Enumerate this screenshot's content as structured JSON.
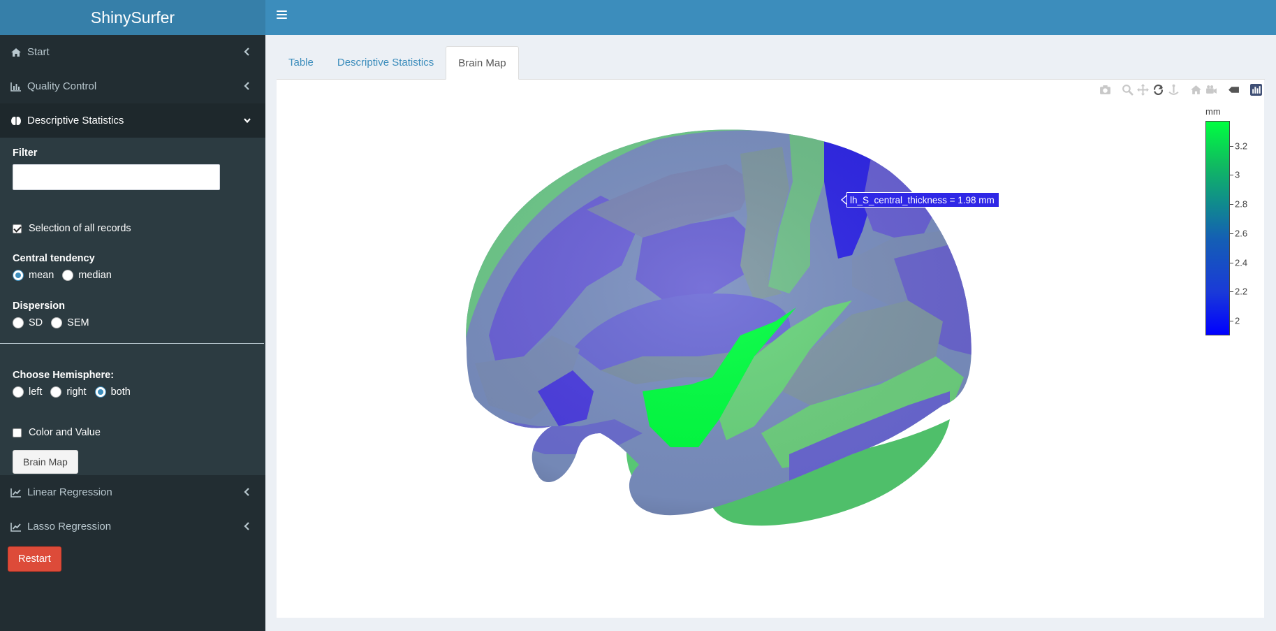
{
  "app": {
    "title": "ShinySurfer"
  },
  "sidebar": {
    "menu": {
      "start": "Start",
      "quality_control": "Quality Control",
      "descriptive_statistics": "Descriptive Statistics",
      "linear_regression": "Linear Regression",
      "lasso_regression": "Lasso Regression"
    },
    "filter": {
      "label": "Filter",
      "value": "",
      "placeholder": ""
    },
    "select_all": {
      "label": "Selection of all records",
      "checked": true
    },
    "central_tendency": {
      "label": "Central tendency",
      "options": [
        "mean",
        "median"
      ],
      "selected": "mean"
    },
    "dispersion": {
      "label": "Dispersion",
      "options": [
        "SD",
        "SEM"
      ],
      "selected": null
    },
    "hemisphere": {
      "label": "Choose Hemisphere:",
      "options": [
        "left",
        "right",
        "both"
      ],
      "selected": "both"
    },
    "color_value": {
      "label": "Color and Value",
      "checked": false
    },
    "brain_map_button": "Brain Map",
    "restart_button": "Restart"
  },
  "tabs": [
    "Table",
    "Descriptive Statistics",
    "Brain Map"
  ],
  "active_tab": "Brain Map",
  "plot": {
    "modebar_icons": [
      "camera-icon",
      "zoom-icon",
      "pan-icon",
      "orbit-rotation-icon",
      "turntable-rotation-icon",
      "home-icon",
      "camera-view-icon",
      "hover-tag-icon",
      "plotly-logo-icon"
    ],
    "hover": {
      "text": "lh_S_central_thickness =  1.98  mm",
      "color": "#2f27e6"
    },
    "colorbar": {
      "title": "mm",
      "ticks": [
        "3.2",
        "3",
        "2.8",
        "2.6",
        "2.4",
        "2.2",
        "2"
      ],
      "tick_values": [
        3.2,
        3.0,
        2.8,
        2.6,
        2.4,
        2.2,
        2.0
      ],
      "min": 1.9,
      "max": 3.37,
      "colors": [
        "#0000ff",
        "#145fb4",
        "#108c8c",
        "#00ff40"
      ]
    }
  },
  "colors": {
    "header": "#3c8dbc",
    "logo_bg": "#367fa9",
    "sidebar_bg": "#222d32",
    "restart": "#dd4b39",
    "region_green": "#6ed38a",
    "region_blue": "#6a64d8",
    "region_gray": "#7f98a8"
  }
}
